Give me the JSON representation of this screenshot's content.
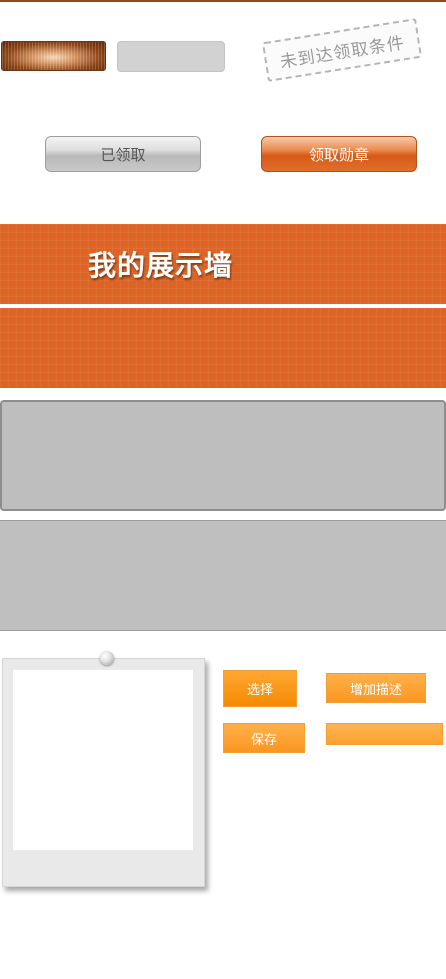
{
  "stamp": {
    "text": "未到达领取条件"
  },
  "buttons": {
    "claimed": "已领取",
    "claim_badge": "领取勋章"
  },
  "banner": {
    "title": "我的展示墙"
  },
  "actions": {
    "select": "选择",
    "add_description": "增加描述",
    "save": "保存"
  },
  "colors": {
    "accent_orange": "#dd6424",
    "button_orange": "#f79513",
    "panel_gray": "#bebebe"
  }
}
